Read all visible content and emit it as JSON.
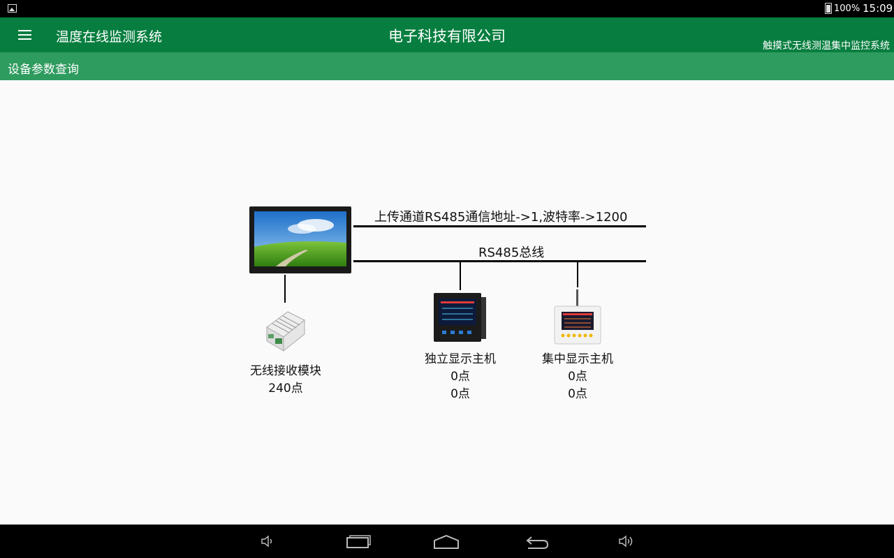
{
  "status_bar": {
    "battery": "100%",
    "time": "15:09"
  },
  "app_bar": {
    "title": "温度在线监测系统",
    "company": "电子科技有限公司",
    "subtitle": "触摸式无线测温集中监控系统"
  },
  "sub_bar": {
    "title": "设备参数查询"
  },
  "diagram": {
    "upload_channel": "上传通道RS485通信地址->1,波特率->1200",
    "bus_label": "RS485总线",
    "wireless_module": {
      "name": "无线接收模块",
      "count": "240点"
    },
    "standalone_host": {
      "name": "独立显示主机",
      "line1": "0点",
      "line2": "0点"
    },
    "central_host": {
      "name": "集中显示主机",
      "line1": "0点",
      "line2": "0点"
    }
  },
  "nav_bar": {
    "icons": [
      "volume-down-icon",
      "recent-apps-icon",
      "home-icon",
      "back-icon",
      "volume-up-icon"
    ]
  }
}
